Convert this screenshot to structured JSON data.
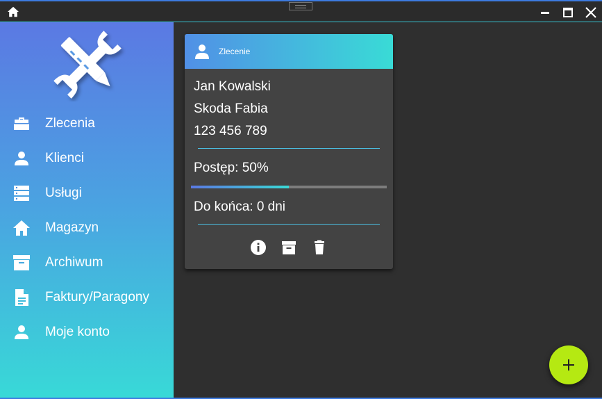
{
  "sidebar": {
    "items": [
      {
        "label": "Zlecenia",
        "icon": "toolbox-icon"
      },
      {
        "label": "Klienci",
        "icon": "person-icon"
      },
      {
        "label": "Usługi",
        "icon": "server-icon"
      },
      {
        "label": "Magazyn",
        "icon": "home-icon"
      },
      {
        "label": "Archiwum",
        "icon": "archive-icon"
      },
      {
        "label": "Faktury/Paragony",
        "icon": "document-icon"
      },
      {
        "label": "Moje konto",
        "icon": "person-icon"
      }
    ]
  },
  "card": {
    "header_title": "Zlecenie",
    "client_name": "Jan Kowalski",
    "vehicle": "Skoda Fabia",
    "phone": "123 456 789",
    "progress_label": "Postęp: 50%",
    "progress_value": 0.5,
    "remaining_label": "Do końca: 0 dni"
  },
  "colors": {
    "accent_blue": "#5b79e3",
    "accent_cyan": "#38d9d7",
    "fab": "#b5e912",
    "background": "#2f2f2f",
    "card": "#434343"
  }
}
